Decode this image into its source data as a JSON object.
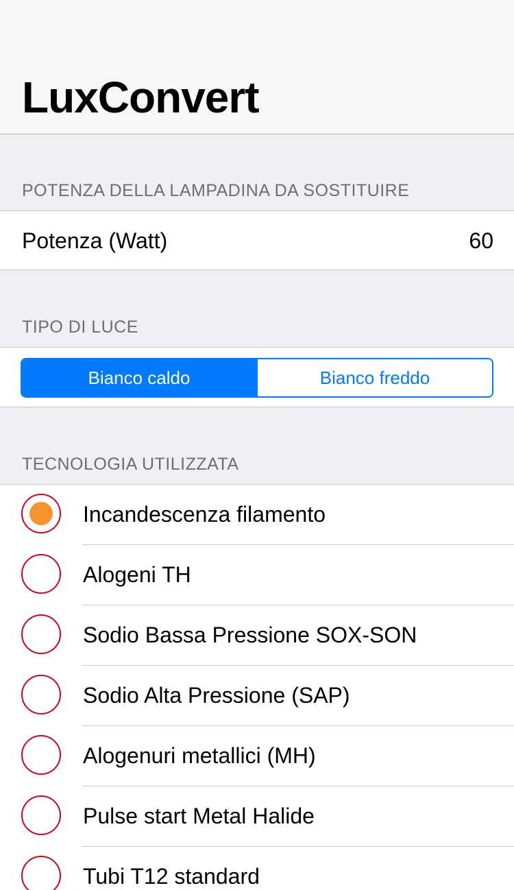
{
  "nav": {
    "title": "LuxConvert"
  },
  "power_section": {
    "header": "POTENZA DELLA LAMPADINA DA SOSTITUIRE",
    "label": "Potenza (Watt)",
    "value": "60"
  },
  "light_section": {
    "header": "TIPO DI LUCE",
    "segments": [
      {
        "label": "Bianco caldo",
        "selected": true
      },
      {
        "label": "Bianco freddo",
        "selected": false
      }
    ]
  },
  "tech_section": {
    "header": "TECNOLOGIA UTILIZZATA",
    "selected_index": 0,
    "options": [
      "Incandescenza filamento",
      "Alogeni TH",
      "Sodio Bassa Pressione SOX-SON",
      "Sodio Alta Pressione (SAP)",
      "Alogenuri metallici (MH)",
      "Pulse start Metal Halide",
      "Tubi T12 standard"
    ]
  },
  "colors": {
    "accent_blue": "#007aff",
    "radio_border": "#d0021b",
    "radio_fill": "#f7942f",
    "group_background": "#efeff4"
  }
}
